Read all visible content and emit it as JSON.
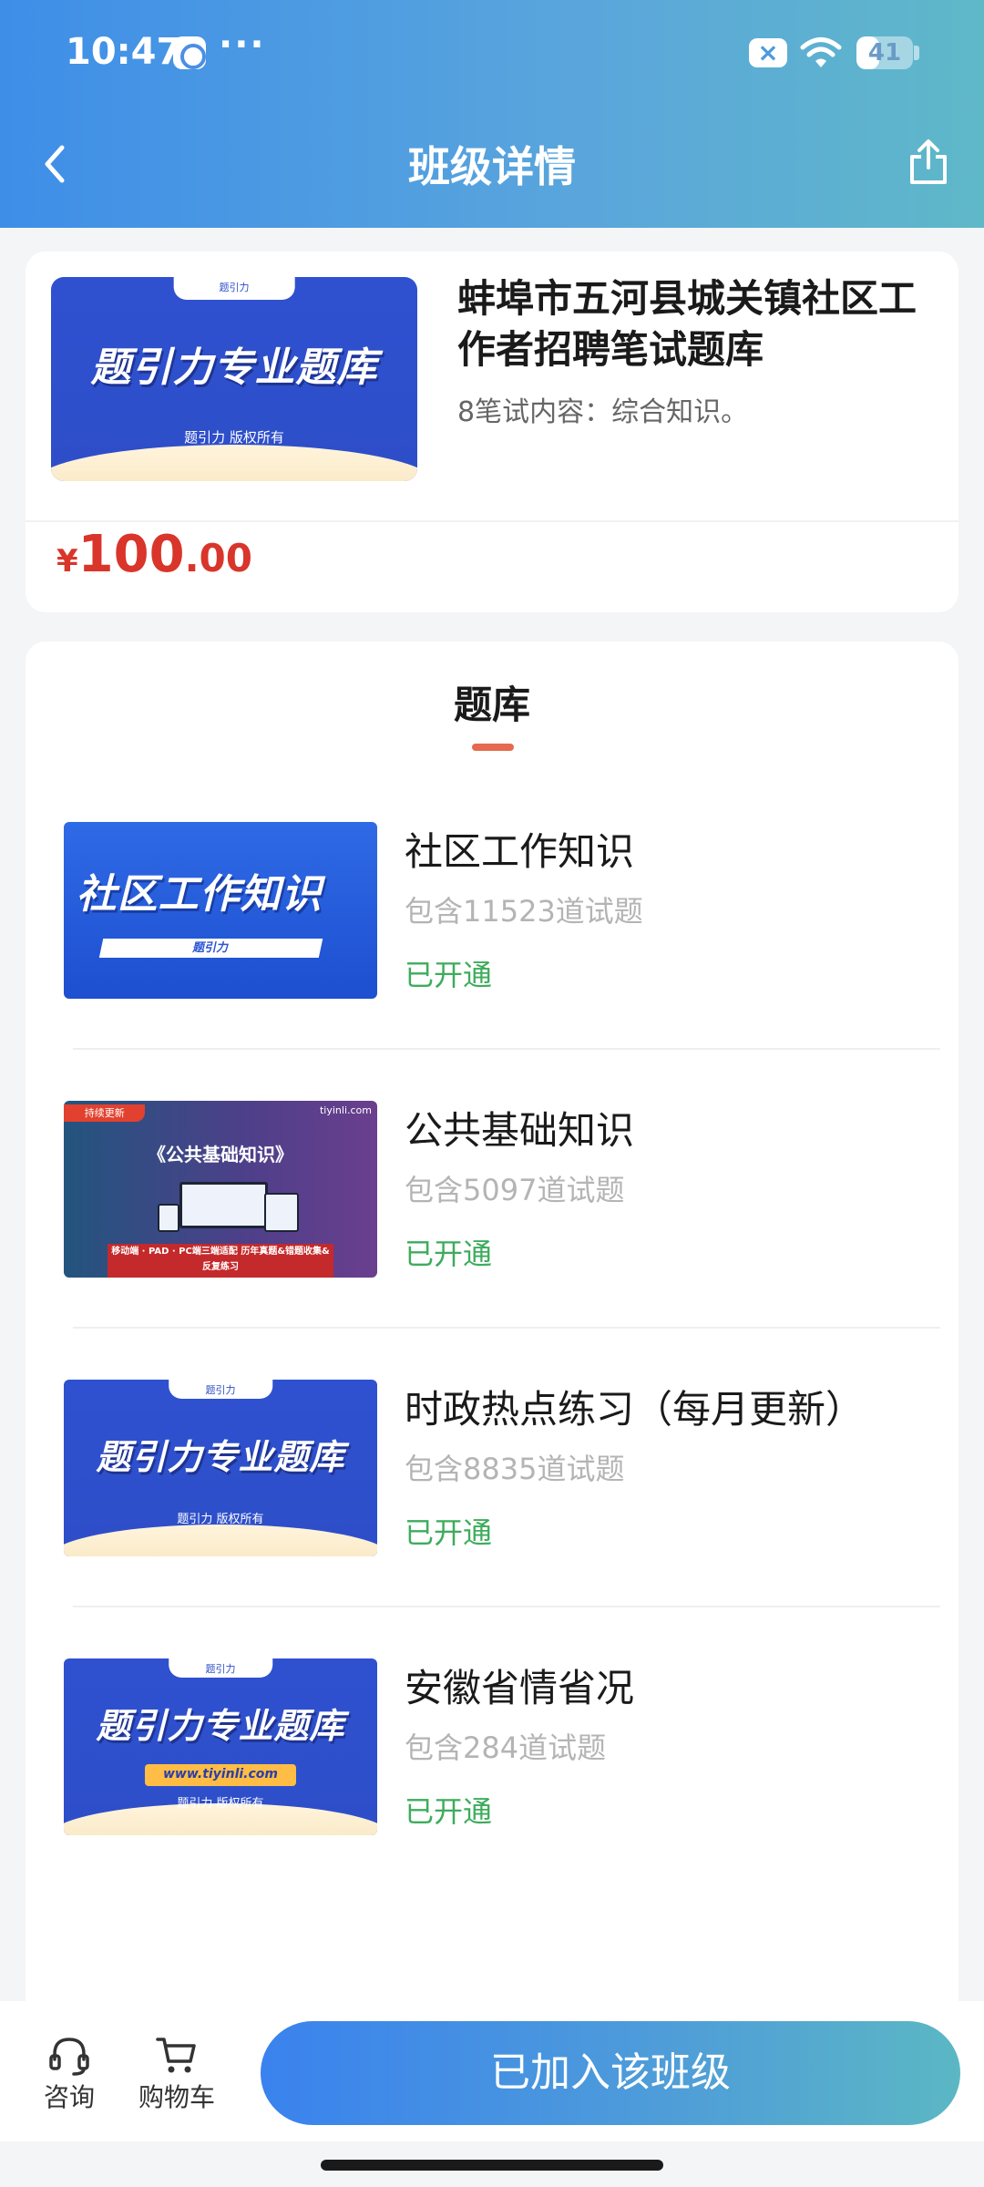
{
  "status_bar": {
    "time": "10:47",
    "dots": "···",
    "battery": "41",
    "battery_level": 0.41
  },
  "nav": {
    "title": "班级详情"
  },
  "course": {
    "title": "蚌埠市五河县城关镇社区工作者招聘笔试题库",
    "subtitle": "8笔试内容：综合知识。",
    "cover": {
      "tab_text": "题引力",
      "headline": "题引力专业题库",
      "footer": "题引力 版权所有"
    },
    "price": {
      "currency": "¥",
      "integer": "100",
      "decimal": ".00"
    }
  },
  "bank": {
    "tab_label": "题库",
    "items": [
      {
        "name": "社区工作知识",
        "count": "包含11523道试题",
        "status": "已开通",
        "cover": {
          "headline": "社区工作知识",
          "bar_text": "题引力"
        }
      },
      {
        "name": "公共基础知识",
        "count": "包含5097道试题",
        "status": "已开通",
        "cover": {
          "tag": "持续更新",
          "brand": "tiyinli.com",
          "headline": "《公共基础知识》",
          "band": "移动端 · PAD · PC端三端适配 历年真题&错题收集&反复练习"
        }
      },
      {
        "name": "时政热点练习（每月更新）",
        "count": "包含8835道试题",
        "status": "已开通",
        "cover": {
          "tab_text": "题引力",
          "headline": "题引力专业题库",
          "footer": "题引力 版权所有"
        }
      },
      {
        "name": "安徽省情省况",
        "count": "包含284道试题",
        "status": "已开通",
        "cover": {
          "tab_text": "题引力",
          "headline": "题引力专业题库",
          "url": "www.tiyinli.com",
          "footer": "题引力 版权所有"
        }
      }
    ]
  },
  "bottom_bar": {
    "consult_label": "咨询",
    "cart_label": "购物车",
    "join_label": "已加入该班级"
  },
  "colors": {
    "accent_blue": "#3e8ee8",
    "price_red": "#d9352b",
    "status_green": "#3dac5c",
    "tab_underline": "#e66a4e"
  }
}
